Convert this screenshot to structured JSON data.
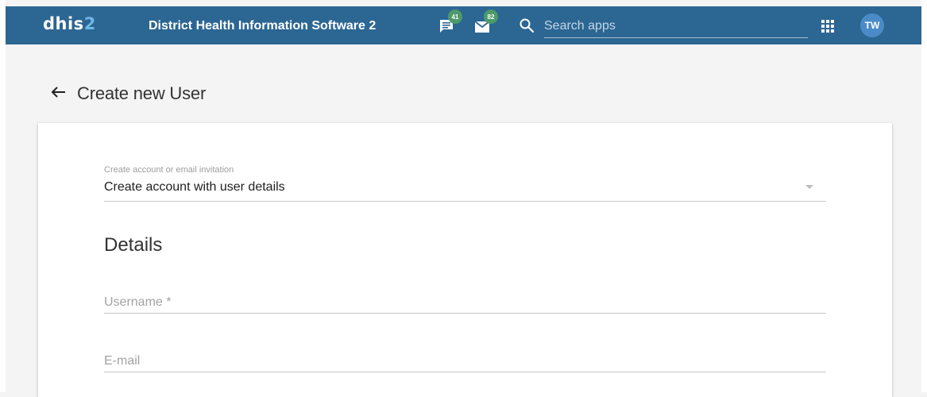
{
  "header": {
    "logo_main": "dhis",
    "logo_accent": "2",
    "app_title": "District Health Information Software 2",
    "messages_badge": "41",
    "interpretations_badge": "82",
    "search_placeholder": "Search apps",
    "avatar_initials": "TW"
  },
  "page": {
    "title": "Create new User"
  },
  "form": {
    "account_type": {
      "label": "Create account or email invitation",
      "value": "Create account with user details"
    },
    "section_title": "Details",
    "username": {
      "placeholder": "Username *"
    },
    "email": {
      "placeholder": "E-mail"
    }
  },
  "colors": {
    "header_bg": "#2c6693",
    "badge_bg": "#4d9a6a",
    "avatar_bg": "#4a8bc7",
    "page_bg": "#f4f4f4"
  },
  "icons": {
    "messages": "message-icon",
    "interpretations": "envelope-icon",
    "search": "search-icon",
    "apps": "apps-grid-icon",
    "back": "arrow-left-icon",
    "dropdown": "caret-down-icon"
  }
}
